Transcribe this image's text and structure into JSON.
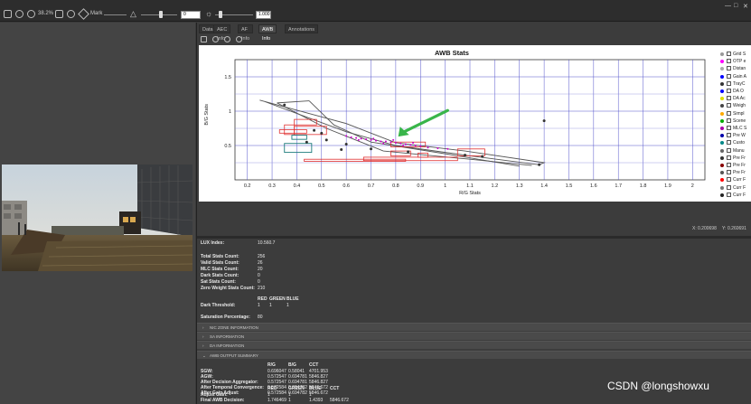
{
  "toolbar": {
    "zoom": "38.2%",
    "mark_label": "Mark",
    "input_left": "0",
    "input_right": "1.000"
  },
  "window_controls": {
    "minimize": "—",
    "maximize": "□",
    "close": "✕"
  },
  "tabs": [
    "Data",
    "AEC Info",
    "AF Info",
    "AWB Info",
    "Annotations"
  ],
  "active_tab_index": 3,
  "coords": {
    "x_label": "X:",
    "x_value": "0.200698",
    "y_label": "Y:",
    "y_value": "0.260691"
  },
  "info": {
    "lux_label": "LUX Index:",
    "lux_value": "10.560.7",
    "total_label": "Total Stats Count:",
    "total_value": "256",
    "valid_label": "Valid Stats Count:",
    "valid_value": "26",
    "mlc_label": "MLC Stats Count:",
    "mlc_value": "20",
    "dark_label": "Dark Stats Count:",
    "dark_value": "0",
    "sat_label": "Sat Stats Count:",
    "sat_value": "0",
    "zero_label": "Zero Weight Stats Count:",
    "zero_value": "210",
    "threshold_headers": [
      "RED",
      "GREEN",
      "BLUE"
    ],
    "dark_threshold_label": "Dark Threshold:",
    "dark_threshold_values": [
      "1",
      "1",
      "1"
    ],
    "saturation_label": "Saturation Percentage:",
    "saturation_value": "80"
  },
  "sections": [
    "NIC ZONE INFORMATION",
    "SA INFORMATION",
    "DA INFORMATION",
    "AWB OUTPUT SUMMARY"
  ],
  "summary": {
    "headers": [
      "R/G",
      "B/G",
      "CCT"
    ],
    "rows": [
      {
        "label": "SGW:",
        "values": [
          "0.696047",
          "0.58041",
          "4701.953"
        ]
      },
      {
        "label": "AGW:",
        "values": [
          "0.572547",
          "0.694781",
          "5846.827"
        ]
      },
      {
        "label": "After Decision Aggregator:",
        "values": [
          "0.572547",
          "0.694781",
          "5846.827"
        ]
      },
      {
        "label": "After Temporal Convergence:",
        "values": [
          "0.572584",
          "0.694782",
          "5846.672"
        ]
      },
      {
        "label": "After Gain Adjust:",
        "values": [
          "0.572584",
          "0.694782",
          "5846.672"
        ]
      }
    ],
    "gain_headers": [
      "RED",
      "GREEN",
      "BLUE",
      "CCT"
    ],
    "adjust_gain_label": "Adjust Gain:",
    "adjust_gain_values": [
      "1",
      "1",
      "1",
      ""
    ],
    "final_label": "Final AWB Decision:",
    "final_values": [
      "1.746469",
      "1",
      "1.4393",
      "5846.672"
    ]
  },
  "watermark": "CSDN @longshowxu",
  "legend": [
    {
      "label": "Grid S",
      "color": "#999999"
    },
    {
      "label": "OTP e",
      "color": "#ff00ff"
    },
    {
      "label": "Distan",
      "color": "#aaaaaa"
    },
    {
      "label": "Gain A",
      "color": "#0000ff"
    },
    {
      "label": "TrayC",
      "color": "#333333"
    },
    {
      "label": "DA O",
      "color": "#0000ff"
    },
    {
      "label": "DA Ac",
      "color": "#dddd00"
    },
    {
      "label": "Weigh",
      "color": "#444444"
    },
    {
      "label": "Simpl",
      "color": "#ffaa00"
    },
    {
      "label": "Scene",
      "color": "#00aa00"
    },
    {
      "label": "MLC S",
      "color": "#aa00aa"
    },
    {
      "label": "Pre W",
      "color": "#0000aa"
    },
    {
      "label": "Custo",
      "color": "#008888"
    },
    {
      "label": "Manu",
      "color": "#666666"
    },
    {
      "label": "Pre Fr",
      "color": "#333333"
    },
    {
      "label": "Pre Fr",
      "color": "#880000"
    },
    {
      "label": "Pre Fr",
      "color": "#555555"
    },
    {
      "label": "Curr F",
      "color": "#ff0000"
    },
    {
      "label": "Curr F",
      "color": "#777777"
    },
    {
      "label": "Curr F",
      "color": "#222222"
    }
  ],
  "chart_data": {
    "type": "scatter",
    "title": "AWB Stats",
    "xlabel": "R/G Stats",
    "ylabel": "B/G Stats",
    "xlim": [
      0.15,
      2.05
    ],
    "ylim": [
      0.0,
      1.75
    ],
    "x_ticks": [
      0.2,
      0.3,
      0.4,
      0.5,
      0.6,
      0.7,
      0.8,
      0.9,
      1.0,
      1.1,
      1.2,
      1.3,
      1.4,
      1.5,
      1.6,
      1.7,
      1.8,
      1.9,
      2.0
    ],
    "x_tick_labels": [
      "0.2",
      "0.3",
      "0.4",
      "0.5",
      "0.6",
      "0.7",
      "0.8",
      "0.9",
      "1",
      "1.1",
      "1.2",
      "1.3",
      "1.4",
      "1.5",
      "1.6",
      "1.7",
      "1.8",
      "1.9",
      "2"
    ],
    "y_ticks": [
      0.5,
      1.0,
      1.5
    ],
    "y_tick_labels": [
      "0.5",
      "1",
      "1.5"
    ],
    "grid": true,
    "legend_position": "right",
    "series": [
      {
        "name": "Simpl",
        "color": "#cc00cc",
        "values": [
          [
            0.6,
            0.64
          ],
          [
            0.62,
            0.62
          ],
          [
            0.64,
            0.61
          ],
          [
            0.66,
            0.6
          ],
          [
            0.68,
            0.59
          ],
          [
            0.7,
            0.58
          ],
          [
            0.72,
            0.57
          ],
          [
            0.74,
            0.56
          ],
          [
            0.76,
            0.56
          ],
          [
            0.78,
            0.55
          ],
          [
            0.8,
            0.54
          ],
          [
            0.82,
            0.53
          ],
          [
            0.84,
            0.52
          ],
          [
            0.86,
            0.51
          ],
          [
            0.88,
            0.5
          ],
          [
            0.9,
            0.49
          ],
          [
            0.65,
            0.58
          ],
          [
            0.71,
            0.6
          ],
          [
            0.75,
            0.53
          ],
          [
            0.79,
            0.58
          ],
          [
            0.83,
            0.5
          ],
          [
            0.87,
            0.54
          ],
          [
            0.93,
            0.47
          ],
          [
            0.97,
            0.46
          ],
          [
            1.01,
            0.45
          ]
        ]
      },
      {
        "name": "TrayC",
        "color": "#333333",
        "values": [
          [
            0.35,
            1.09
          ],
          [
            0.47,
            0.72
          ],
          [
            0.5,
            0.68
          ],
          [
            0.52,
            0.58
          ],
          [
            0.6,
            0.52
          ],
          [
            0.7,
            0.45
          ],
          [
            0.85,
            0.41
          ],
          [
            1.08,
            0.36
          ],
          [
            1.15,
            0.34
          ],
          [
            1.38,
            0.22
          ],
          [
            1.4,
            0.86
          ],
          [
            0.44,
            0.55
          ],
          [
            0.58,
            0.44
          ]
        ]
      }
    ],
    "polylines": [
      [
        [
          0.25,
          1.16
        ],
        [
          0.6,
          0.82
        ],
        [
          0.8,
          0.54
        ],
        [
          1.08,
          0.42
        ],
        [
          1.4,
          0.25
        ],
        [
          1.38,
          0.22
        ],
        [
          1.08,
          0.36
        ],
        [
          0.8,
          0.5
        ],
        [
          0.6,
          0.7
        ],
        [
          0.27,
          1.14
        ]
      ],
      [
        [
          0.32,
          1.12
        ],
        [
          0.52,
          0.75
        ],
        [
          0.75,
          0.42
        ],
        [
          1.1,
          0.3
        ],
        [
          1.35,
          0.21
        ]
      ],
      [
        [
          0.45,
          1.15
        ],
        [
          0.55,
          0.8
        ],
        [
          0.7,
          0.55
        ],
        [
          1.0,
          0.38
        ],
        [
          1.3,
          0.2
        ]
      ],
      [
        [
          0.45,
          1.15
        ],
        [
          0.32,
          1.12
        ]
      ]
    ],
    "red_boxes": [
      [
        [
          0.39,
          0.48
        ],
        [
          0.8,
          0.88
        ]
      ],
      [
        [
          0.33,
          0.44
        ],
        [
          0.68,
          0.73
        ]
      ],
      [
        [
          0.35,
          0.39
        ],
        [
          0.66,
          0.8
        ]
      ],
      [
        [
          0.39,
          0.52
        ],
        [
          0.66,
          0.78
        ]
      ],
      [
        [
          0.78,
          0.92
        ],
        [
          0.48,
          0.55
        ]
      ],
      [
        [
          0.78,
          0.86
        ],
        [
          0.35,
          0.42
        ]
      ],
      [
        [
          0.89,
          0.93
        ],
        [
          0.33,
          0.39
        ]
      ],
      [
        [
          1.05,
          1.16
        ],
        [
          0.35,
          0.45
        ]
      ],
      [
        [
          0.67,
          1.05
        ],
        [
          0.28,
          0.33
        ]
      ],
      [
        [
          0.43,
          0.84
        ],
        [
          0.27,
          0.3
        ]
      ]
    ],
    "teal_boxes": [
      [
        [
          0.35,
          0.46
        ],
        [
          0.4,
          0.53
        ]
      ],
      [
        [
          0.38,
          0.44
        ],
        [
          0.59,
          0.65
        ]
      ]
    ],
    "arrow": {
      "from": [
        1.01,
        1.01
      ],
      "to": [
        0.81,
        0.63
      ]
    }
  }
}
